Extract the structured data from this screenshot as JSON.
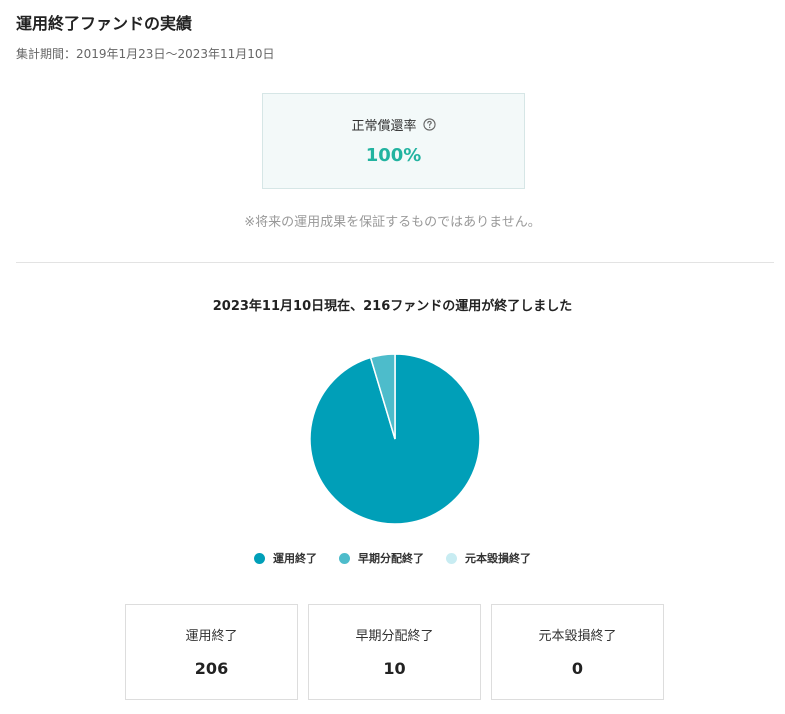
{
  "header": {
    "title": "運用終了ファンドの実績",
    "period": "集計期間：2019年1月23日〜2023年11月10日"
  },
  "rate": {
    "label": "正常償還率",
    "value": "100%",
    "help_icon": "question-circle-icon"
  },
  "disclaimer": "※将来の運用成果を保証するものではありません。",
  "chart_data": {
    "type": "pie",
    "title": "2023年11月10日現在、216ファンドの運用が終了しました",
    "categories": [
      "運用終了",
      "早期分配終了",
      "元本毀損終了"
    ],
    "values": [
      206,
      10,
      0
    ],
    "colors": [
      "#009fb8",
      "#4dbccb",
      "#c8ecf2"
    ],
    "legend_position": "bottom"
  },
  "stats": [
    {
      "label": "運用終了",
      "value": "206"
    },
    {
      "label": "早期分配終了",
      "value": "10"
    },
    {
      "label": "元本毀損終了",
      "value": "0"
    }
  ]
}
